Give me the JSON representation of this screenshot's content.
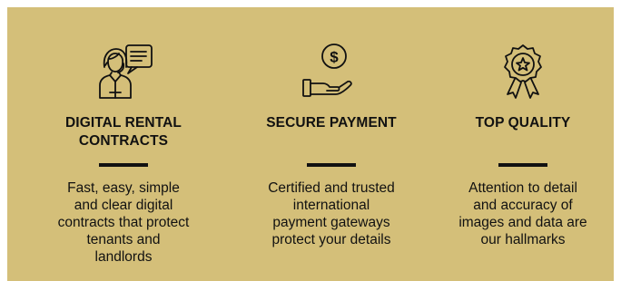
{
  "features": [
    {
      "icon": "contract-agent-icon",
      "title": "DIGITAL RENTAL\nCONTRACTS",
      "description": "Fast, easy, simple\nand clear digital\ncontracts that protect\ntenants and\nlandlords"
    },
    {
      "icon": "secure-payment-icon",
      "title": "SECURE PAYMENT",
      "description": "Certified and trusted\ninternational\npayment gateways\nprotect your details"
    },
    {
      "icon": "quality-badge-icon",
      "title": "TOP QUALITY",
      "description": "Attention to detail\nand accuracy of\nimages and data are\nour hallmarks"
    }
  ],
  "colors": {
    "panel_background": "#d4bf79",
    "text": "#111111"
  }
}
